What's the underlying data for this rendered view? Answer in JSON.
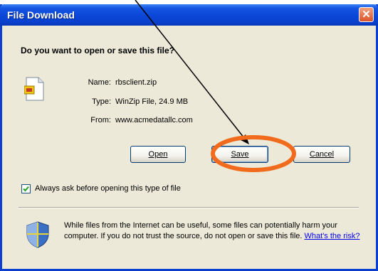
{
  "window": {
    "title": "File Download"
  },
  "dialog": {
    "question": "Do you want to open or save this file?",
    "file_info": [
      {
        "label": "Name:",
        "value": "rbsclient.zip"
      },
      {
        "label": "Type:",
        "value": "WinZip File, 24.9 MB"
      },
      {
        "label": "From:",
        "value": "www.acmedatallc.com"
      }
    ],
    "buttons": {
      "open": "Open",
      "save": "Save",
      "cancel": "Cancel"
    },
    "checkbox": {
      "label": "Always ask before opening this type of file",
      "checked": true
    },
    "warning": {
      "text": "While files from the Internet can be useful, some files can potentially harm your computer. If you do not trust the source, do not open or save this file.",
      "link": "What's the risk?"
    }
  },
  "annotation": {
    "highlight_color": "#f26a1b",
    "arrow_color": "#000000",
    "target": "Save"
  },
  "icons": {
    "close": "close-icon",
    "file": "zip-file-icon",
    "check": "checkmark-icon",
    "shield": "security-shield-icon"
  }
}
